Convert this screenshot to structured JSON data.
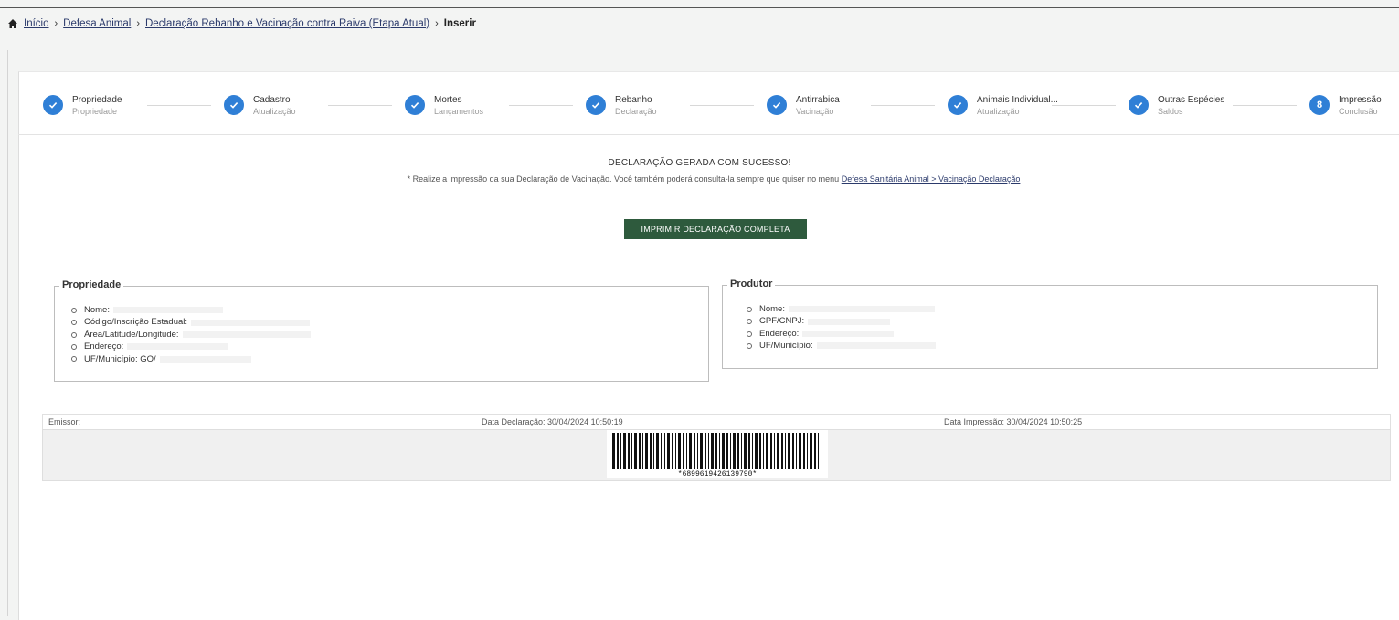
{
  "breadcrumb": {
    "home": "Início",
    "items": [
      "Defesa Animal",
      "Declaração Rebanho e Vacinação contra Raiva (Etapa Atual)"
    ],
    "current": "Inserir"
  },
  "stepper": [
    {
      "title": "Propriedade",
      "subtitle": "Propriedade",
      "icon": "check-icon"
    },
    {
      "title": "Cadastro",
      "subtitle": "Atualização",
      "icon": "check-icon"
    },
    {
      "title": "Mortes",
      "subtitle": "Lançamentos",
      "icon": "check-icon"
    },
    {
      "title": "Rebanho",
      "subtitle": "Declaração",
      "icon": "check-icon"
    },
    {
      "title": "Antirrabica",
      "subtitle": "Vacinação",
      "icon": "check-icon"
    },
    {
      "title": "Animais Individual...",
      "subtitle": "Atualização",
      "icon": "check-icon"
    },
    {
      "title": "Outras Espécies",
      "subtitle": "Saldos",
      "icon": "check-icon"
    },
    {
      "title": "Impressão",
      "subtitle": "Conclusão",
      "number": "8"
    }
  ],
  "success": {
    "title": "DECLARAÇÃO GERADA COM SUCESSO!",
    "message": "* Realize a impressão da sua Declaração de Vacinação. Você também poderá consulta-la sempre que quiser no menu",
    "link": "Defesa Sanitária Animal > Vacinação Declaração"
  },
  "print_button": "IMPRIMIR DECLARAÇÃO COMPLETA",
  "propriedade": {
    "legend": "Propriedade",
    "items": [
      {
        "label": "Nome:",
        "value": ""
      },
      {
        "label": "Código/Inscrição Estadual:",
        "value": ""
      },
      {
        "label": "Área/Latitude/Longitude:",
        "value": ""
      },
      {
        "label": "Endereço:",
        "value": ""
      },
      {
        "label": "UF/Município: GO/",
        "value": ""
      }
    ]
  },
  "produtor": {
    "legend": "Produtor",
    "items": [
      {
        "label": "Nome:",
        "value": ""
      },
      {
        "label": "CPF/CNPJ:",
        "value": ""
      },
      {
        "label": "Endereço:",
        "value": ""
      },
      {
        "label": "UF/Município:",
        "value": ""
      }
    ]
  },
  "footer": {
    "emissor": "Emissor:",
    "data_declaracao": "Data Declaração: 30/04/2024 10:50:19",
    "data_impressao": "Data Impressão: 30/04/2024 10:50:25"
  },
  "barcode": {
    "number": "*6899619426139790*"
  },
  "colors": {
    "step_circle": "#2f7fd6",
    "print_button": "#2e5a3d",
    "link": "#2b3a6b"
  }
}
